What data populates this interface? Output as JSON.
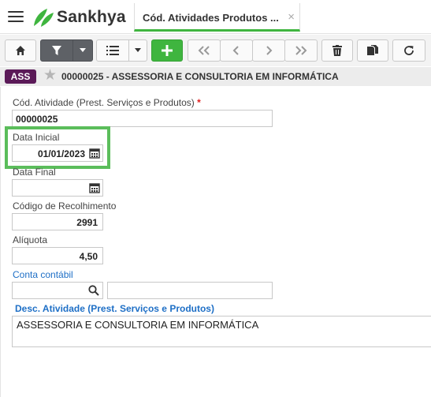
{
  "app": {
    "brand": "Sankhya",
    "tab_title": "Cód. Atividades Produtos ...",
    "tab_close": "×"
  },
  "toolbar": {
    "buttons": [
      "home-icon",
      "filter-icon",
      "dropdown-icon",
      "list-icon",
      "dropdown-icon",
      "add-icon",
      "first-icon",
      "prev-icon",
      "next-icon",
      "last-icon",
      "delete-icon",
      "copy-icon",
      "refresh-icon"
    ]
  },
  "record": {
    "badge": "ASS",
    "title": "00000025 - ASSESSORIA E CONSULTORIA EM INFORMÁTICA"
  },
  "form": {
    "cod_atividade": {
      "label": "Cód. Atividade (Prest. Serviços e Produtos)",
      "required_mark": "*",
      "value": "00000025"
    },
    "data_inicial": {
      "label": "Data Inicial",
      "value": "01/01/2023"
    },
    "data_final": {
      "label": "Data Final",
      "value": ""
    },
    "codigo_recolhimento": {
      "label": "Código de Recolhimento",
      "value": "2991"
    },
    "aliquota": {
      "label": "Alíquota",
      "value": "4,50"
    },
    "conta_contabil": {
      "label": "Conta contábil",
      "code": "",
      "description": ""
    },
    "desc_atividade": {
      "label": "Desc. Atividade (Prest. Serviços e Produtos)",
      "value": "ASSESSORIA E CONSULTORIA EM INFORMÁTICA"
    }
  },
  "colors": {
    "accent": "#3fb53f",
    "badge": "#5b1a58",
    "link": "#1e6fc6",
    "required": "#e02020"
  }
}
